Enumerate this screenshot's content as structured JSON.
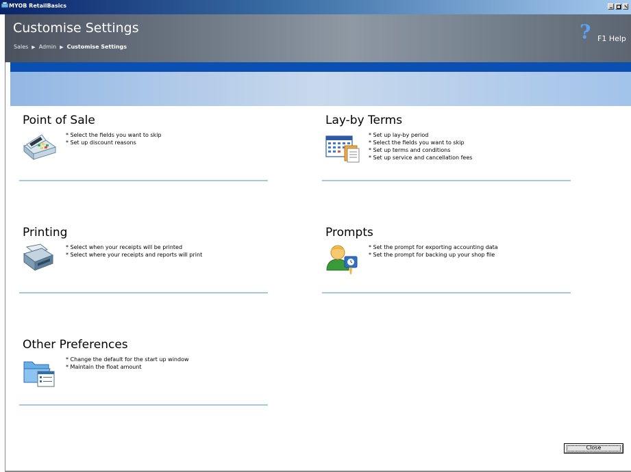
{
  "window": {
    "title": "MYOB RetailBasics"
  },
  "header": {
    "title": "Customise Settings",
    "breadcrumb": [
      "Sales",
      "Admin",
      "Customise Settings"
    ],
    "help_label": "F1 Help",
    "help_glyph": "?"
  },
  "sections": [
    {
      "title": "Point of Sale",
      "icon": "cash-register-icon",
      "items": [
        "* Select the fields you want to skip",
        "* Set up discount reasons"
      ]
    },
    {
      "title": "Lay-by Terms",
      "icon": "calendar-document-icon",
      "items": [
        "* Set up lay-by period",
        "* Select the fields you want to skip",
        "* Set up terms and conditions",
        "* Set up service and cancellation fees"
      ]
    },
    {
      "title": "Printing",
      "icon": "printer-icon",
      "items": [
        "* Select when your receipts will be printed",
        "* Select where your receipts and reports will print"
      ]
    },
    {
      "title": "Prompts",
      "icon": "user-clock-icon",
      "items": [
        "* Set the prompt for exporting accounting data",
        "* Set the prompt for backing up your shop file"
      ]
    },
    {
      "title": "Other Preferences",
      "icon": "folder-preferences-icon",
      "items": [
        "* Change the default for the start up window",
        "* Maintain the float amount"
      ]
    }
  ],
  "buttons": {
    "close_label": "Close"
  },
  "colors": {
    "accent_blue": "#0b4fb3",
    "divider": "#a9c4e2",
    "header_gray": "#6d7783"
  }
}
